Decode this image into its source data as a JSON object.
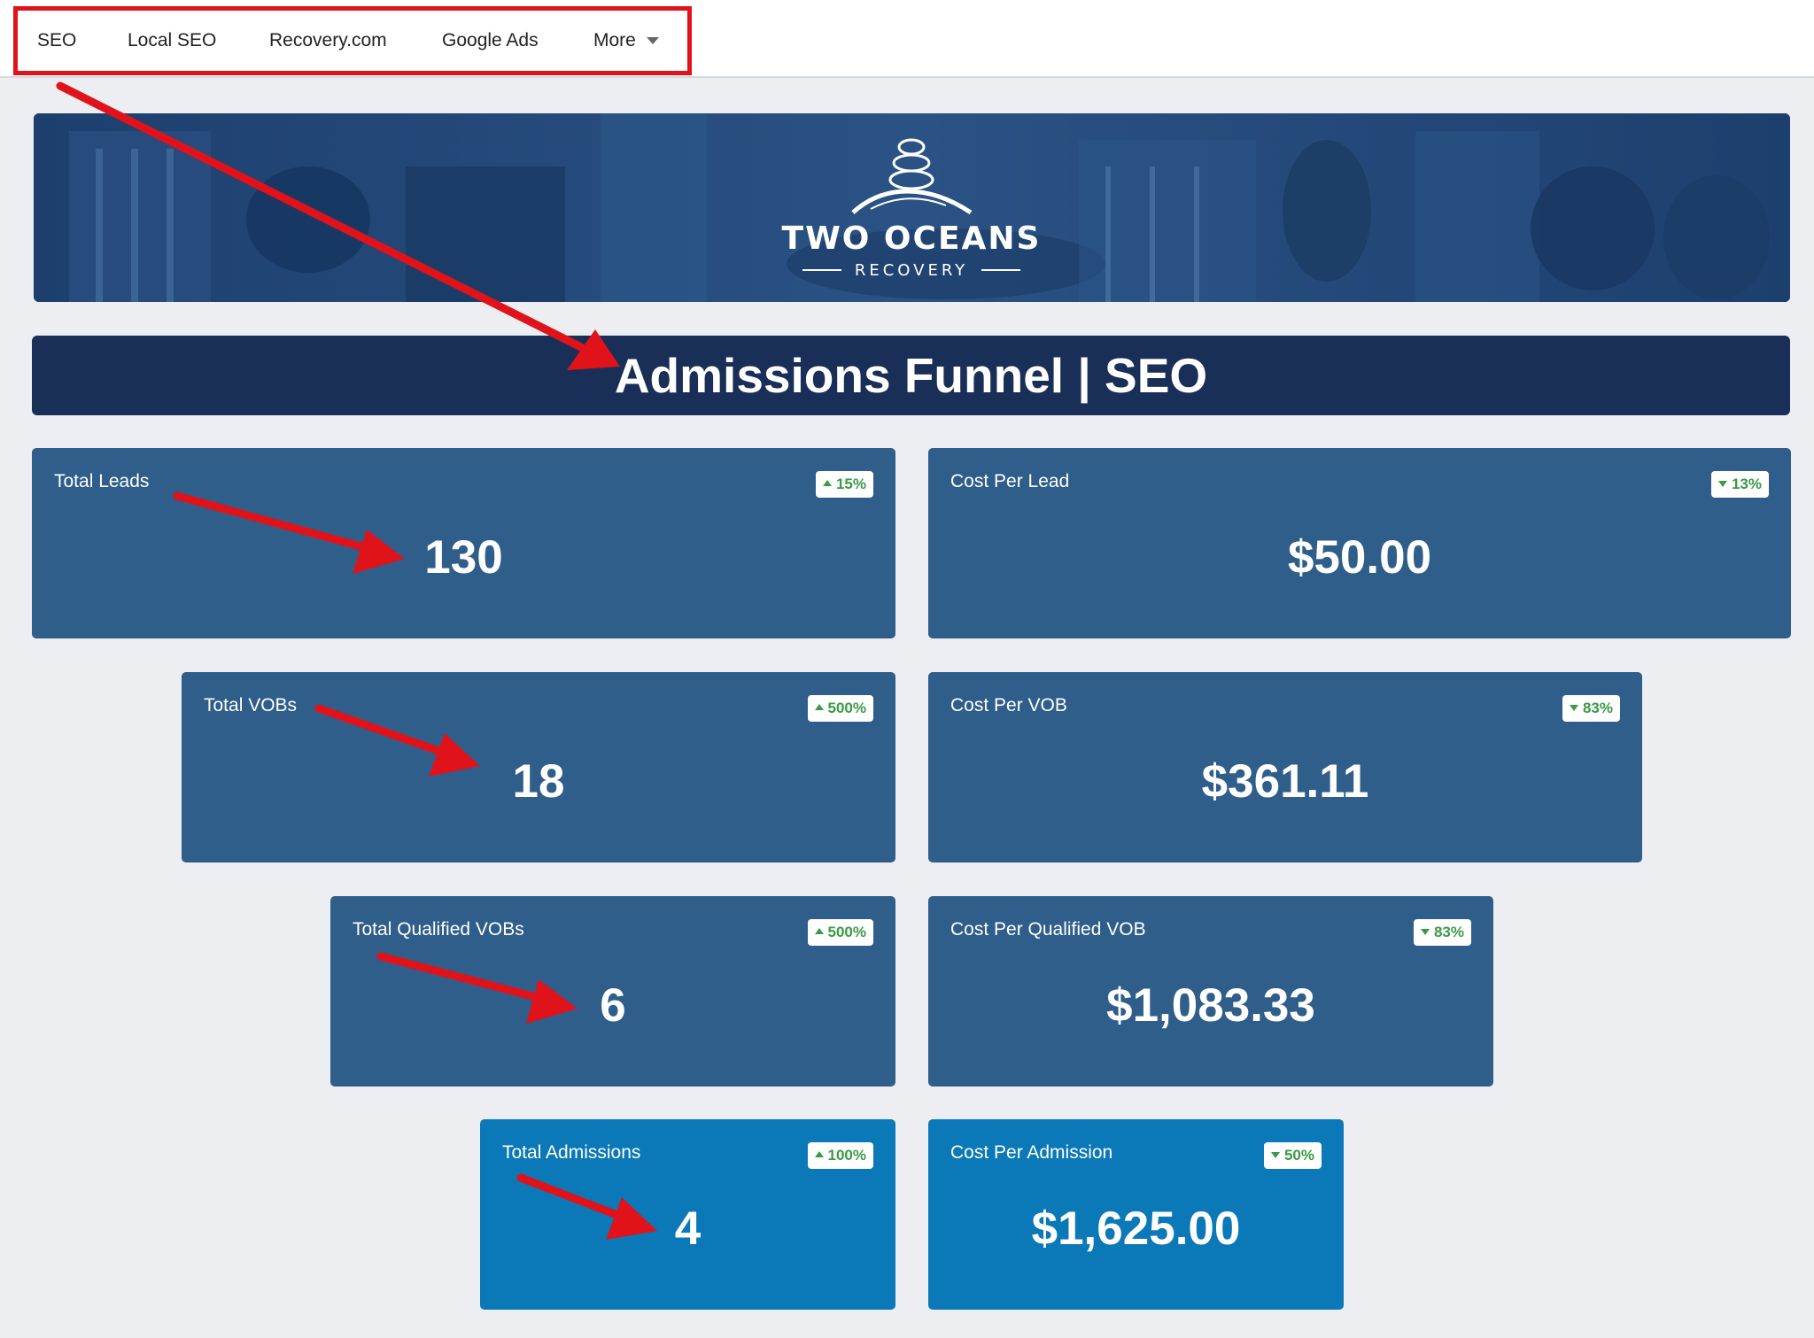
{
  "nav": {
    "items": [
      {
        "label": "SEO"
      },
      {
        "label": "Local SEO"
      },
      {
        "label": "Recovery.com"
      },
      {
        "label": "Google Ads"
      },
      {
        "label": "More"
      }
    ]
  },
  "banner": {
    "logo_name": "TWO OCEANS",
    "logo_sub": "RECOVERY",
    "logo_icon": "stacked-stones-wave-icon"
  },
  "page_title": "Admissions Funnel | SEO",
  "metrics": {
    "total_leads": {
      "label": "Total Leads",
      "value": "130",
      "change": "15%",
      "direction": "up"
    },
    "cost_per_lead": {
      "label": "Cost Per Lead",
      "value": "$50.00",
      "change": "13%",
      "direction": "down"
    },
    "total_vobs": {
      "label": "Total VOBs",
      "value": "18",
      "change": "500%",
      "direction": "up"
    },
    "cost_per_vob": {
      "label": "Cost Per VOB",
      "value": "$361.11",
      "change": "83%",
      "direction": "down"
    },
    "total_qualified_vobs": {
      "label": "Total Qualified VOBs",
      "value": "6",
      "change": "500%",
      "direction": "up"
    },
    "cost_per_qualified_vob": {
      "label": "Cost Per Qualified VOB",
      "value": "$1,083.33",
      "change": "83%",
      "direction": "down"
    },
    "total_admissions": {
      "label": "Total Admissions",
      "value": "4",
      "change": "100%",
      "direction": "up"
    },
    "cost_per_admission": {
      "label": "Cost Per Admission",
      "value": "$1,625.00",
      "change": "50%",
      "direction": "down"
    }
  },
  "colors": {
    "page_bg": "#eceef2",
    "title_bar": "#1a2f57",
    "card": "#2f5e8a",
    "card_highlight": "#0b78b8",
    "badge_text": "#3a9a45",
    "annotation": "#e0131b"
  }
}
